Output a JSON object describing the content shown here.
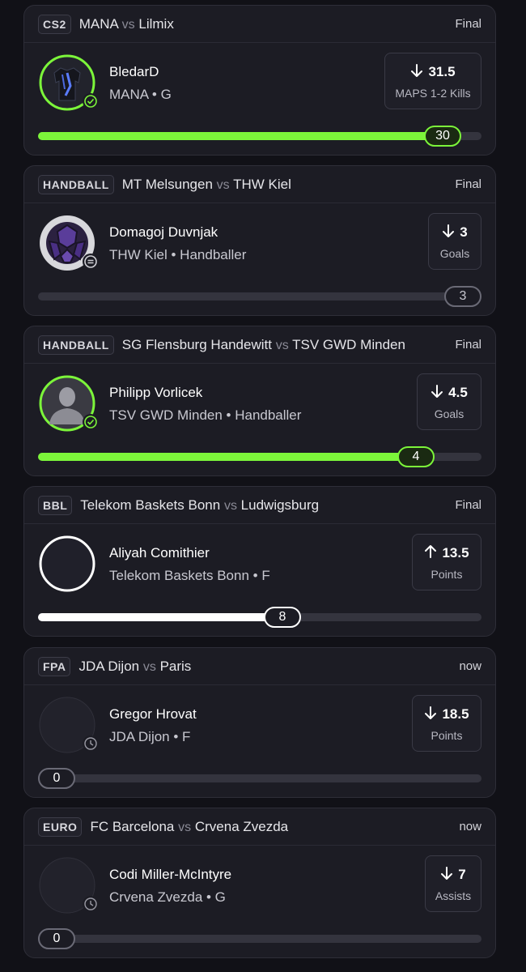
{
  "colors": {
    "green": "#7cf53a",
    "white": "#ffffff",
    "track": "#34343e"
  },
  "cards": [
    {
      "league": "CS2",
      "team_a": "MANA",
      "vs": "vs",
      "team_b": "Lilmix",
      "status": "Final",
      "player": "BledarD",
      "sub": "MANA • G",
      "direction": "down",
      "line": "31.5",
      "stat": "MAPS 1-2 Kills",
      "result": "30",
      "progress": 0.95,
      "bar": "green",
      "avatar": "jersey",
      "badge": "check-icon"
    },
    {
      "league": "HANDBALL",
      "team_a": "MT Melsungen",
      "vs": "vs",
      "team_b": "THW Kiel",
      "status": "Final",
      "player": "Domagoj Duvnjak",
      "sub": "THW Kiel • Handballer",
      "direction": "down",
      "line": "3",
      "stat": "Goals",
      "result": "3",
      "progress": 1.0,
      "bar": "grey",
      "avatar": "handball",
      "badge": "equal-icon"
    },
    {
      "league": "HANDBALL",
      "team_a": "SG Flensburg Handewitt",
      "vs": "vs",
      "team_b": "TSV GWD Minden",
      "status": "Final",
      "player": "Philipp Vorlicek",
      "sub": "TSV GWD Minden • Handballer",
      "direction": "down",
      "line": "4.5",
      "stat": "Goals",
      "result": "4",
      "progress": 0.89,
      "bar": "green",
      "avatar": "silhouette",
      "badge": "check-icon"
    },
    {
      "league": "BBL",
      "team_a": "Telekom Baskets Bonn",
      "vs": "vs",
      "team_b": "Ludwigsburg",
      "status": "Final",
      "player": "Aliyah Comithier",
      "sub": "Telekom Baskets Bonn • F",
      "direction": "up",
      "line": "13.5",
      "stat": "Points",
      "result": "8",
      "progress": 0.59,
      "bar": "white",
      "avatar": "empty-ring",
      "badge": ""
    },
    {
      "league": "FPA",
      "team_a": "JDA Dijon",
      "vs": "vs",
      "team_b": "Paris",
      "status": "now",
      "player": "Gregor Hrovat",
      "sub": "JDA Dijon • F",
      "direction": "down",
      "line": "18.5",
      "stat": "Points",
      "result": "0",
      "progress": 0,
      "bar": "none",
      "avatar": "empty",
      "badge": "clock-icon"
    },
    {
      "league": "EURO",
      "team_a": "FC Barcelona",
      "vs": "vs",
      "team_b": "Crvena Zvezda",
      "status": "now",
      "player": "Codi Miller-McIntyre",
      "sub": "Crvena Zvezda • G",
      "direction": "down",
      "line": "7",
      "stat": "Assists",
      "result": "0",
      "progress": 0,
      "bar": "none",
      "avatar": "empty",
      "badge": "clock-icon"
    }
  ]
}
